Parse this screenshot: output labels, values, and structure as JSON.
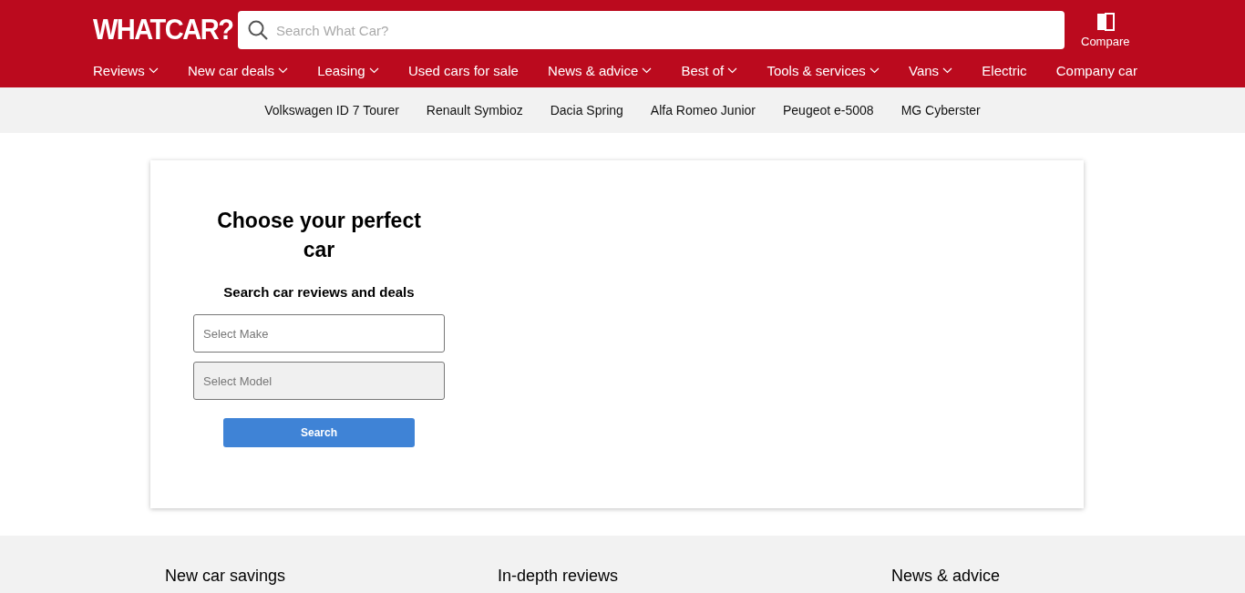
{
  "header": {
    "logo": "WHATCAR?",
    "search": {
      "placeholder": "Search What Car?"
    },
    "compare": "Compare"
  },
  "nav": [
    {
      "label": "Reviews",
      "has_menu": true
    },
    {
      "label": "New car deals",
      "has_menu": true
    },
    {
      "label": "Leasing",
      "has_menu": true
    },
    {
      "label": "Used cars for sale",
      "has_menu": false
    },
    {
      "label": "News & advice",
      "has_menu": true
    },
    {
      "label": "Best of",
      "has_menu": true
    },
    {
      "label": "Tools & services",
      "has_menu": true
    },
    {
      "label": "Vans",
      "has_menu": true
    },
    {
      "label": "Electric",
      "has_menu": false
    },
    {
      "label": "Company car",
      "has_menu": false
    }
  ],
  "trending": [
    "Volkswagen ID 7 Tourer",
    "Renault Symbioz",
    "Dacia Spring",
    "Alfa Romeo Junior",
    "Peugeot e-5008",
    "MG Cyberster"
  ],
  "finder": {
    "title": "Choose your perfect car",
    "subtitle": "Search car reviews and deals",
    "selects": [
      {
        "placeholder": "Select Make",
        "disabled": false
      },
      {
        "placeholder": "Select Model",
        "disabled": true
      }
    ],
    "button": "Search"
  },
  "sections": [
    "New car savings",
    "In-depth reviews",
    "News & advice"
  ]
}
